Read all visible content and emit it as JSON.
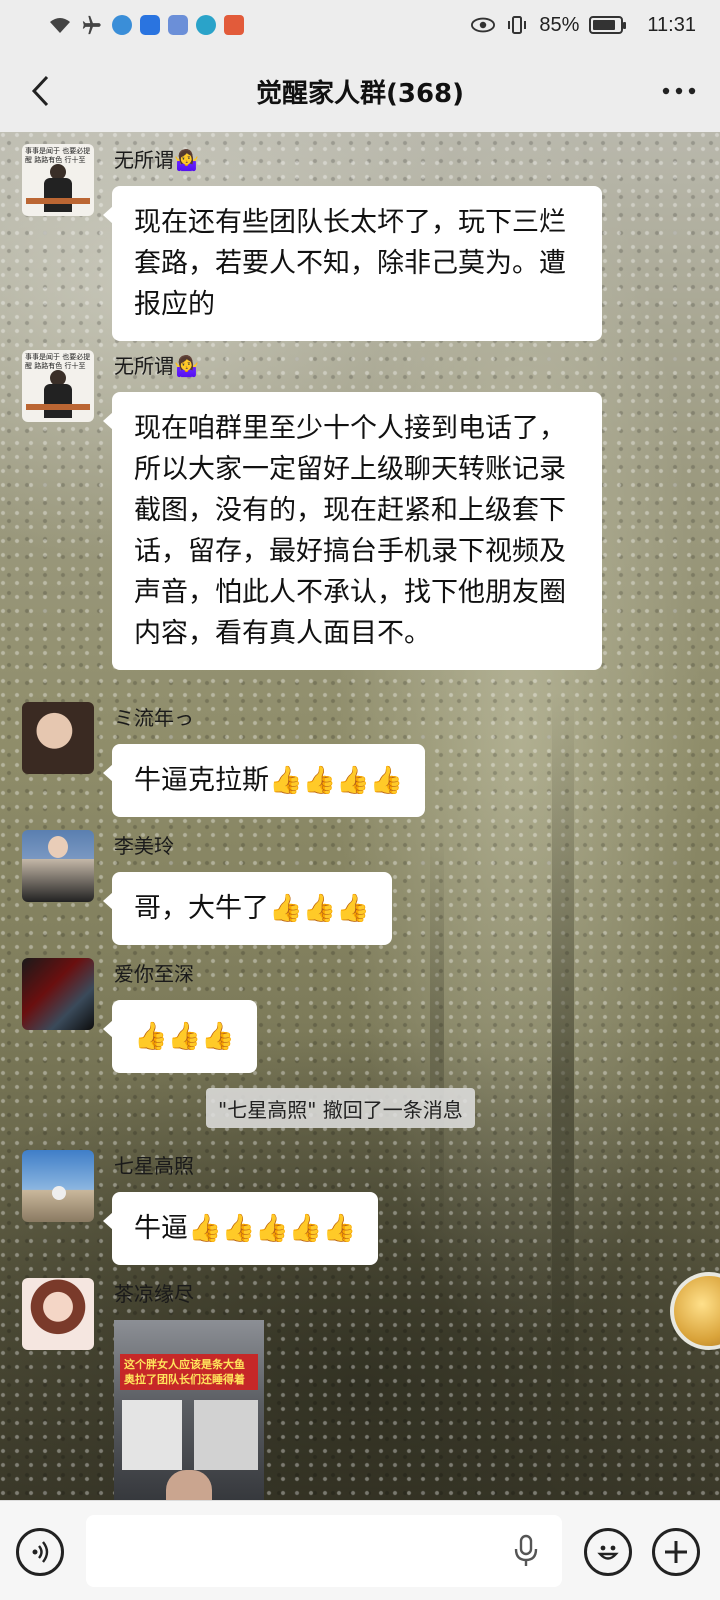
{
  "status_bar": {
    "battery_percent": "85%",
    "battery_level": 0.85,
    "time": "11:31",
    "icons": [
      "wifi-icon",
      "airplane-icon",
      "app-icon",
      "app-icon",
      "music-app-icon",
      "app-icon",
      "app-icon",
      "eye-icon",
      "vibrate-icon",
      "battery-icon"
    ]
  },
  "header": {
    "title": "觉醒家人群(368)",
    "back_icon": "chevron-left-icon",
    "more_icon": "more-dots-icon"
  },
  "messages": [
    {
      "sender": "无所谓🤷‍♀️",
      "text": "现在还有些团队长太坏了，玩下三烂套路，若要人不知，除非己莫为。遭报应的",
      "avatar": "avatar-speaker-photo"
    },
    {
      "sender": "无所谓🤷‍♀️",
      "text": "现在咱群里至少十个人接到电话了，所以大家一定留好上级聊天转账记录截图，没有的，现在赶紧和上级套下话，留存，最好搞台手机录下视频及声音，怕此人不承认，找下他朋友圈内容，看有真人面目不。",
      "avatar": "avatar-speaker-photo"
    },
    {
      "sender": "ミ流年っ",
      "text": "牛逼克拉斯👍👍👍👍",
      "avatar": "avatar-woman-photo"
    },
    {
      "sender": "李美玲",
      "text": "哥，大牛了👍👍👍",
      "avatar": "avatar-woman-suit-photo"
    },
    {
      "sender": "爱你至深",
      "text": "👍👍👍",
      "avatar": "avatar-anime-photo"
    },
    {
      "sender": "七星高照",
      "text": "牛逼👍👍👍👍👍",
      "avatar": "avatar-landscape-photo"
    },
    {
      "sender": "茶凉缘尽",
      "image_caption": "这个胖女人应该是条大鱼 奥拉了团队长们还睡得着",
      "avatar": "avatar-illustration-photo"
    }
  ],
  "system_notice": "\"七星高照\" 撤回了一条消息",
  "avatar_texts": {
    "avatar1": "事事是闻于 也要必提醒 路路有色 行十至",
    "avatar2": "事事是闻于 也要必提醒 路路有色 行十至"
  },
  "input_bar": {
    "voice_icon": "voice-icon",
    "mic_icon": "microphone-icon",
    "emoji_icon": "emoji-icon",
    "plus_icon": "plus-icon"
  }
}
